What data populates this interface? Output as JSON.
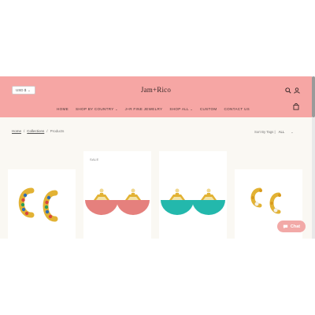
{
  "header": {
    "currency": "USD $",
    "logo": "Jam+Rico"
  },
  "nav": {
    "items": [
      {
        "label": "HOME",
        "has_chevron": false
      },
      {
        "label": "SHOP BY COUNTRY",
        "has_chevron": true
      },
      {
        "label": "J+R FINE JEWELRY",
        "has_chevron": false
      },
      {
        "label": "SHOP ALL",
        "has_chevron": true
      },
      {
        "label": "CUSTOM",
        "has_chevron": false
      },
      {
        "label": "CONTACT US",
        "has_chevron": false
      }
    ],
    "chevron": "⌄"
  },
  "breadcrumb": {
    "home": "Home",
    "collections": "Collections",
    "current": "Products",
    "separator": "/"
  },
  "sort": {
    "label": "Sort By Tags |",
    "value": "ALL"
  },
  "products": [
    {
      "badge": "",
      "image": "gold-hoop-earrings-with-colored-stones"
    },
    {
      "badge": "SALE",
      "image": "pink-fan-tassel-earrings"
    },
    {
      "badge": "",
      "image": "turquoise-fan-tassel-earrings"
    },
    {
      "badge": "",
      "image": "gold-pearl-hoop-earrings"
    }
  ],
  "chat": {
    "label": "Chat"
  },
  "colors": {
    "header_bg": "#f6a6a4",
    "page_bg": "#faf8f3",
    "gold": "#e2b234",
    "pink_fan": "#e5807d",
    "turquoise_fan": "#23b8ac",
    "chat_bg": "#f2a9a7"
  }
}
